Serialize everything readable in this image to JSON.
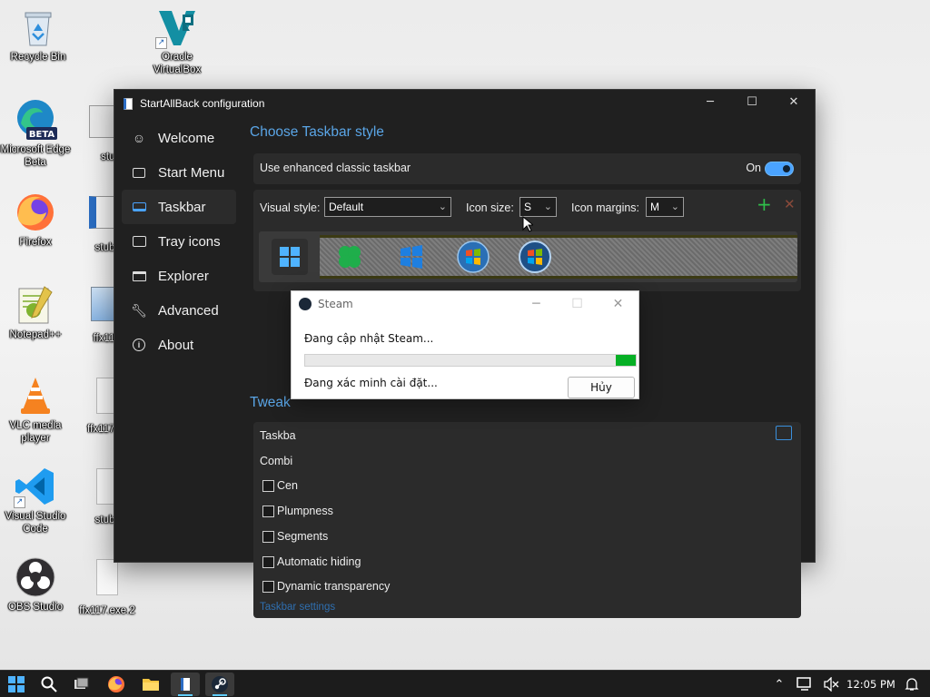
{
  "desktop": {
    "icons": [
      {
        "label": "Recycle Bin"
      },
      {
        "label": "Oracle VirtualBox"
      },
      {
        "label": "Microsoft Edge Beta",
        "badge": "BETA"
      },
      {
        "label": "stu..."
      },
      {
        "label": "Firefox"
      },
      {
        "label": "stub..."
      },
      {
        "label": "Notepad++"
      },
      {
        "label": "ffx11..."
      },
      {
        "label": "VLC media player"
      },
      {
        "label": "ffx117..."
      },
      {
        "label": "Visual Studio Code"
      },
      {
        "label": "stub..."
      },
      {
        "label": "OBS Studio"
      },
      {
        "label": "ffx117.exe.2"
      }
    ]
  },
  "config_window": {
    "title": "StartAllBack configuration",
    "controls": {
      "minimize": "─",
      "maximize": "☐",
      "close": "✕"
    },
    "nav": [
      {
        "label": "Welcome",
        "icon": "smile-icon"
      },
      {
        "label": "Start Menu",
        "icon": "start-menu-icon"
      },
      {
        "label": "Taskbar",
        "icon": "taskbar-icon",
        "active": true
      },
      {
        "label": "Tray icons",
        "icon": "tray-icon"
      },
      {
        "label": "Explorer",
        "icon": "folder-icon"
      },
      {
        "label": "Advanced",
        "icon": "wrench-icon"
      },
      {
        "label": "About",
        "icon": "info-icon"
      }
    ],
    "section_title": "Choose Taskbar style",
    "enhanced_label": "Use enhanced classic taskbar",
    "enhanced_state": "On",
    "visual_style_label": "Visual style:",
    "visual_style_value": "Default",
    "icon_size_label": "Icon size:",
    "icon_size_value": "S",
    "icon_margins_label": "Icon margins:",
    "icon_margins_value": "M",
    "tweaks_title": "Tweak",
    "tweaks_row1": "Taskba",
    "tweaks_row2": "Combi",
    "checkboxes": [
      {
        "label": "Cen"
      },
      {
        "label": "Plumpness"
      },
      {
        "label": "Segments"
      },
      {
        "label": "Automatic hiding"
      },
      {
        "label": "Dynamic transparency"
      }
    ],
    "settings_link": "Taskbar settings"
  },
  "steam_dialog": {
    "title": "Steam",
    "status": "Đang cập nhật Steam...",
    "progress_fraction": 0.06,
    "detail": "Đang xác minh cài đặt...",
    "cancel_label": "Hủy"
  },
  "taskbar": {
    "clock": "12:05 PM"
  },
  "colors": {
    "accent": "#4aa3ff",
    "section_title": "#5aa5e6",
    "progress": "#06b025",
    "window_bg": "#202020",
    "card_bg": "#2b2b2b"
  }
}
